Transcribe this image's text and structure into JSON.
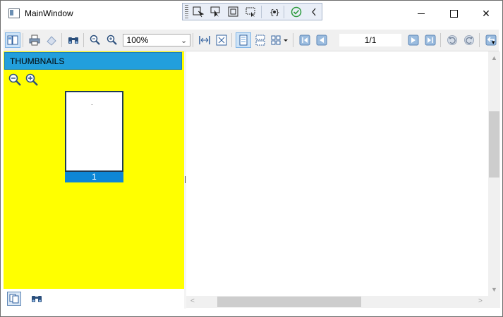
{
  "window": {
    "title": "MainWindow",
    "min_label": "",
    "close_glyph": "✕"
  },
  "debug_toolbar": {
    "icons": [
      "select-element-icon",
      "pointer-icon",
      "layout-adorner-icon",
      "track-focus-icon",
      "binding-failures-icon",
      "check-icon",
      "collapse-chevron-icon"
    ]
  },
  "toolbar": {
    "zoom_value": "100%",
    "zoom_arrow": "⌄",
    "page_indicator": "1/1",
    "overflow_glyph": "▾"
  },
  "thumbnails": {
    "header": "THUMBNAILS",
    "pages": [
      {
        "label": "1"
      }
    ],
    "dots": ".."
  },
  "colors": {
    "panel_bg": "#ffff00",
    "header_bg": "#229fdc",
    "selected_page_bg": "#0d86d6",
    "scrollbar_thumb": "#cdcdcd"
  },
  "scroll": {
    "up": "▲",
    "down": "▼",
    "left": "<",
    "right": ">"
  }
}
